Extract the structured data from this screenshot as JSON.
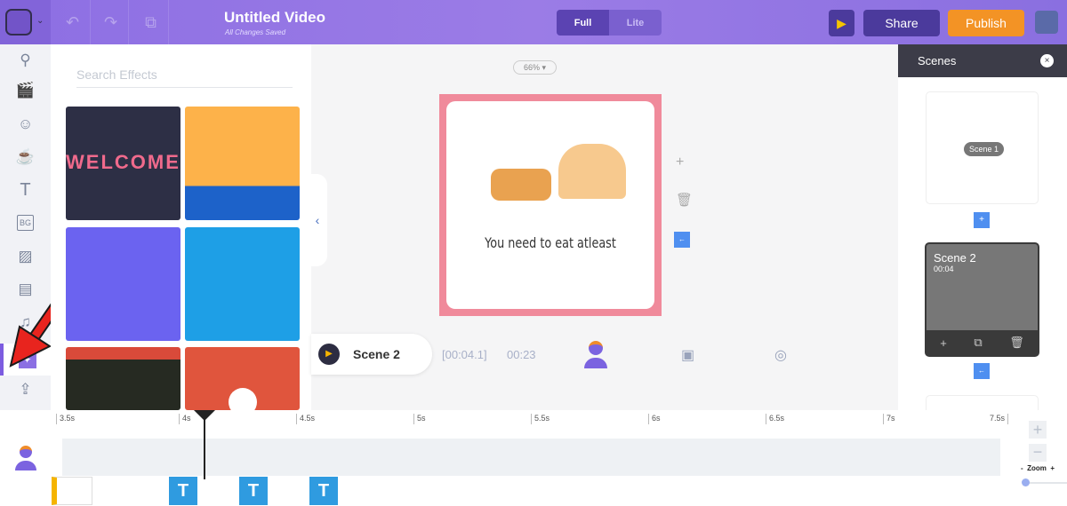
{
  "header": {
    "title": "Untitled Video",
    "status": "All Changes Saved",
    "modes": [
      "Full",
      "Lite"
    ],
    "active_mode": "Full",
    "share_label": "Share",
    "publish_label": "Publish",
    "accent": "#f39325"
  },
  "sidebar": {
    "items": [
      "search-icon",
      "scene-icon",
      "character-icon",
      "props-icon",
      "text-icon",
      "background-icon",
      "image-icon",
      "video-icon",
      "music-icon",
      "effects-icon",
      "upload-icon"
    ],
    "active": "effects-icon",
    "text_icon": "T",
    "bg_icon": "BG"
  },
  "effects": {
    "placeholder": "Search Effects",
    "thumbnails": [
      "welcome",
      "orange-balloons",
      "purple-balloons",
      "blue-bunting",
      "dark-bunting",
      "red-video"
    ]
  },
  "canvas": {
    "zoom": "66% ▾",
    "caption": "You need to eat atleast"
  },
  "playbar": {
    "scene": "Scene 2",
    "current_time": "[00:04.1]",
    "total_time": "00:23"
  },
  "scenes_panel": {
    "title": "Scenes",
    "scenes": [
      {
        "label": "Scene 1"
      },
      {
        "label": "Scene 2",
        "duration": "00:04"
      }
    ]
  },
  "timeline": {
    "ticks": [
      "3.5s",
      "4s",
      "4.5s",
      "5s",
      "5.5s",
      "6s",
      "6.5s",
      "7s",
      "7.5s"
    ],
    "text_block": "T",
    "zoom_label": "Zoom",
    "zoom_minus": "-",
    "zoom_plus": "+"
  }
}
